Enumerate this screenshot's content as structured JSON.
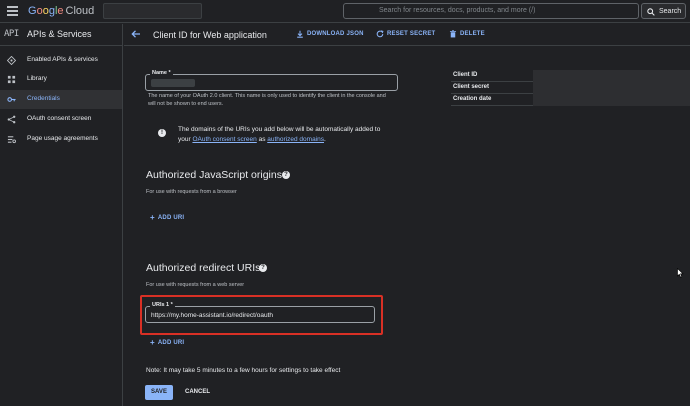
{
  "topbar": {
    "logo_google": [
      "G",
      "o",
      "o",
      "g",
      "l",
      "e"
    ],
    "logo_cloud": "Cloud",
    "search_placeholder": "Search for resources, docs, products, and more (/)",
    "search_button": "Search"
  },
  "sidebar": {
    "api_badge": "API",
    "title": "APIs & Services",
    "items": [
      {
        "label": "Enabled APIs & services",
        "icon": "diamond-icon",
        "active": false
      },
      {
        "label": "Library",
        "icon": "library-icon",
        "active": false
      },
      {
        "label": "Credentials",
        "icon": "key-icon",
        "active": true
      },
      {
        "label": "OAuth consent screen",
        "icon": "consent-icon",
        "active": false
      },
      {
        "label": "Page usage agreements",
        "icon": "settings-list-icon",
        "active": false
      }
    ]
  },
  "header": {
    "title": "Client ID for Web application",
    "download": "DOWNLOAD JSON",
    "reset": "RESET SECRET",
    "delete": "DELETE"
  },
  "form": {
    "name_label": "Name *",
    "name_hint": "The name of your OAuth 2.0 client. This name is only used to identify the client in the console and will not be shown to end users.",
    "info_text_1": "The domains of the URIs you add below will be automatically added to your ",
    "info_link_1": "OAuth consent screen",
    "info_text_2": " as ",
    "info_link_2": "authorized domains",
    "info_text_3": ".",
    "js_origins_title": "Authorized JavaScript origins",
    "js_origins_sub": "For use with requests from a browser",
    "add_uri_1": "ADD URI",
    "redirect_title": "Authorized redirect URIs",
    "redirect_sub": "For use with requests from a web server",
    "uri_label": "URIs 1 *",
    "uri_value": "https://my.home-assistant.io/redirect/oauth",
    "add_uri_2": "ADD URI",
    "note": "Note: It may take 5 minutes to a few hours for settings to take effect",
    "save": "SAVE",
    "cancel": "CANCEL"
  },
  "details": {
    "client_id": "Client ID",
    "client_secret": "Client secret",
    "creation_date": "Creation date"
  },
  "colors": {
    "accent": "#8ab4f8",
    "background": "#202124",
    "highlight_border": "#d93025"
  }
}
